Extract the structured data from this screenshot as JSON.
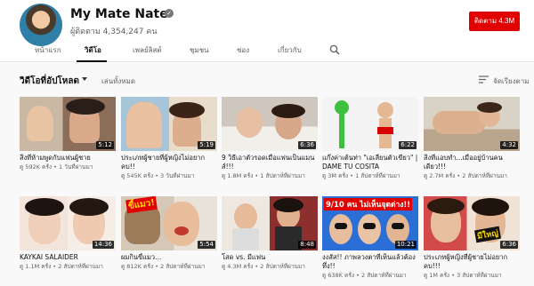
{
  "channel": {
    "name": "My Mate Nate",
    "subscribers": "ผู้ติดตาม 4,354,247 คน",
    "subscribe_label": "ติดตาม 4.3M"
  },
  "tabs": [
    {
      "label": "หน้าแรก"
    },
    {
      "label": "วิดีโอ"
    },
    {
      "label": "เพลย์ลิสต์"
    },
    {
      "label": "ชุมชน"
    },
    {
      "label": "ช่อง"
    },
    {
      "label": "เกี่ยวกับ"
    }
  ],
  "section": {
    "title": "วิดีโอที่อัปโหลด",
    "play_all": "เล่นทั้งหมด",
    "sort_label": "จัดเรียงตาม"
  },
  "videos": [
    {
      "title": "สิ่งที่ห้ามพูดกับแฟนผู้ชาย",
      "meta": "ดู 592K ครั้ง • 1 วันที่ผ่านมา",
      "duration": "5:12"
    },
    {
      "title": "ประเภทผู้ชายที่ผู้หญิงไม่อยากคบ!!",
      "meta": "ดู 545K ครั้ง • 3 วันที่ผ่านมา",
      "duration": "5:19"
    },
    {
      "title": "9 วิธีเอาตัวรอดเมื่อแฟนเป็นแมนส์!!!",
      "meta": "ดู 1.8M ครั้ง • 1 สัปดาห์ที่ผ่านมา",
      "duration": "6:36"
    },
    {
      "title": "แก๊งค่าเต้นท่า \"เอเลี่ยนตัวเขียว\" | DAME TU COSITA",
      "meta": "ดู 3M ครั้ง • 1 สัปดาห์ที่ผ่านมา",
      "duration": "6:22"
    },
    {
      "title": "สิ่งที่แอบทำ...เมื่ออยู่บ้านคนเดียว!!!",
      "meta": "ดู 2.7M ครั้ง • 2 สัปดาห์ที่ผ่านมา",
      "duration": "4:32"
    },
    {
      "title": "KAYKAI SALAIDER",
      "meta": "ดู 1.1M ครั้ง • 2 สัปดาห์ที่ผ่านมา",
      "duration": "14:36"
    },
    {
      "title": "ผมกินขี้แมว...",
      "meta": "ดู 812K ครั้ง • 2 สัปดาห์ที่ผ่านมา",
      "duration": "5:54"
    },
    {
      "title": "โสด vs. มีแฟน",
      "meta": "ดู 4.3M ครั้ง • 2 สัปดาห์ที่ผ่านมา",
      "duration": "8:48"
    },
    {
      "title": "งงสัส!! ภาพลวงตาที่เห็นแล้วต้องทึ่ง!!",
      "meta": "ดู 638K ครั้ง • 2 สัปดาห์ที่ผ่านมา",
      "duration": "10:21"
    },
    {
      "title": "ประเภทผู้หญิงที่ผู้ชายไม่อยากคบ!!!",
      "meta": "ดู 1M ครั้ง • 3 สัปดาห์ที่ผ่านมา",
      "duration": "6:36"
    }
  ],
  "thumb_text": {
    "v7_overlay": "ขี้แมว!",
    "v9_top": "9/10 คน ไม่เห็นจุดต่าง!!",
    "v10_overlay": "มีใหญ่"
  },
  "colors": {
    "subscribe": "#e00000",
    "thumb_badge_red": "#e00000",
    "thumb_badge_yellow": "#ffd800"
  }
}
